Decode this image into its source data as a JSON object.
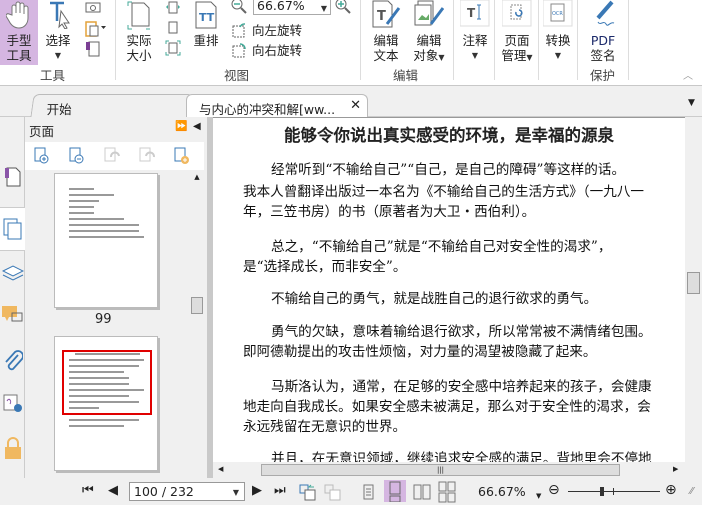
{
  "ribbon": {
    "hand_tool": "手型\n工具",
    "hand_l1": "手型",
    "hand_l2": "工具",
    "select": "选择",
    "group_tools": "工具",
    "actual_size_l1": "实际",
    "actual_size_l2": "大小",
    "reflow": "重排",
    "zoom_value": "66.67%",
    "rotate_left": "向左旋转",
    "rotate_right": "向右旋转",
    "group_view": "视图",
    "edit_text_l1": "编辑",
    "edit_text_l2": "文本",
    "edit_obj_l1": "编辑",
    "edit_obj_l2": "对象",
    "group_edit": "编辑",
    "comment": "注释",
    "page_mgmt_l1": "页面",
    "page_mgmt_l2": "管理",
    "convert": "转换",
    "pdf_sign_l1": "PDF",
    "pdf_sign_l2": "签名",
    "group_protect": "保护",
    "accent": "#d5b6e1"
  },
  "tabs": [
    {
      "label": "开始"
    },
    {
      "label": "与内心的冲突和解[ww..."
    }
  ],
  "panel": {
    "title": "页面",
    "thumbs": [
      {
        "label": "99"
      },
      {
        "label": ""
      }
    ]
  },
  "document": {
    "title": "能够令你说出真实感受的环境，是幸福的源泉",
    "lines": [
      "经常听到“不输给自己”“自己，是自己的障碍”等这样的话。",
      "我本人曾翻译出版过一本名为《不输给自己的生活方式》（一九八一",
      "年，三笠书房）的书（原著者为大卫・西伯利）。",
      "总之，“不输给自己”就是“不输给自己对安全性的渴求”，",
      "是“选择成长，而非安全”。",
      "不输给自己的勇气，就是战胜自己的退行欲求的勇气。",
      "勇气的欠缺，意味着输给退行欲求，所以常常被不满情绪包围。",
      "即阿德勒提出的攻击性烦恼，对力量的渴望被隐藏了起来。",
      "马斯洛认为，通常，在足够的安全感中培养起来的孩子，会健康",
      "地走向自我成长。如果安全感未被满足，那么对于安全性的渴求，会",
      "永远残留在无意识的世界。",
      "并且，在无意识领域，继续追求安全感的满足。背地里会不停地"
    ]
  },
  "status": {
    "page_input": "100 / 232",
    "zoom": "66.67%"
  }
}
